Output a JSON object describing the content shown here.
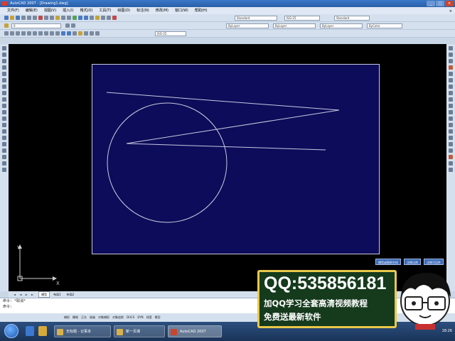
{
  "window": {
    "title": "AutoCAD 2007 - [Drawing1.dwg]",
    "controls": [
      "_",
      "□",
      "×"
    ]
  },
  "menu": {
    "items": [
      "文件(F)",
      "编辑(E)",
      "视图(V)",
      "插入(I)",
      "格式(O)",
      "工具(T)",
      "绘图(D)",
      "标注(N)",
      "修改(M)",
      "窗口(W)",
      "帮助(H)"
    ],
    "close": "×"
  },
  "toolbar": {
    "layer_combo": "0",
    "style_combo": "ByLayer",
    "linetype_combo": "ByLayer",
    "lineweight_combo": "ByLayer",
    "plot_style_combo": "ByColor",
    "textstyle_combo": "Standard",
    "dimstyle_combo": "ISO-25"
  },
  "layout_tabs": {
    "arrows": "◄ ◄ ► ►",
    "tabs": [
      "模型",
      "布局1",
      "布局2"
    ],
    "active": "模型"
  },
  "ucs": {
    "y_label": "Y",
    "x_label": "X"
  },
  "viewport_buttons": [
    "模型或图纸空间",
    "注释比例",
    "注释可见性"
  ],
  "command": {
    "lines": [
      "命令: *取消*",
      "命令:",
      ""
    ]
  },
  "statusbar": {
    "coordinates": "",
    "toggles": [
      "捕捉",
      "栅格",
      "正交",
      "极轴",
      "对象捕捉",
      "对象追踪",
      "DUCS",
      "DYN",
      "线宽",
      "模型"
    ]
  },
  "taskbar": {
    "buttons": [
      "无标题 - 记事本",
      "新一页课",
      "AutoCAD 2007"
    ],
    "clock": "18:26"
  },
  "promo": {
    "qq": "QQ:535856181",
    "line1": "加QQ学习全套高清视频教程",
    "line2": "免费送最新软件"
  },
  "colors": {
    "drawing_background": "#000000",
    "sheet_background": "#0c0c5a",
    "geometry_stroke": "#c8c8e0",
    "promo_bg": "#153a1c",
    "promo_border": "#e9c84a"
  }
}
